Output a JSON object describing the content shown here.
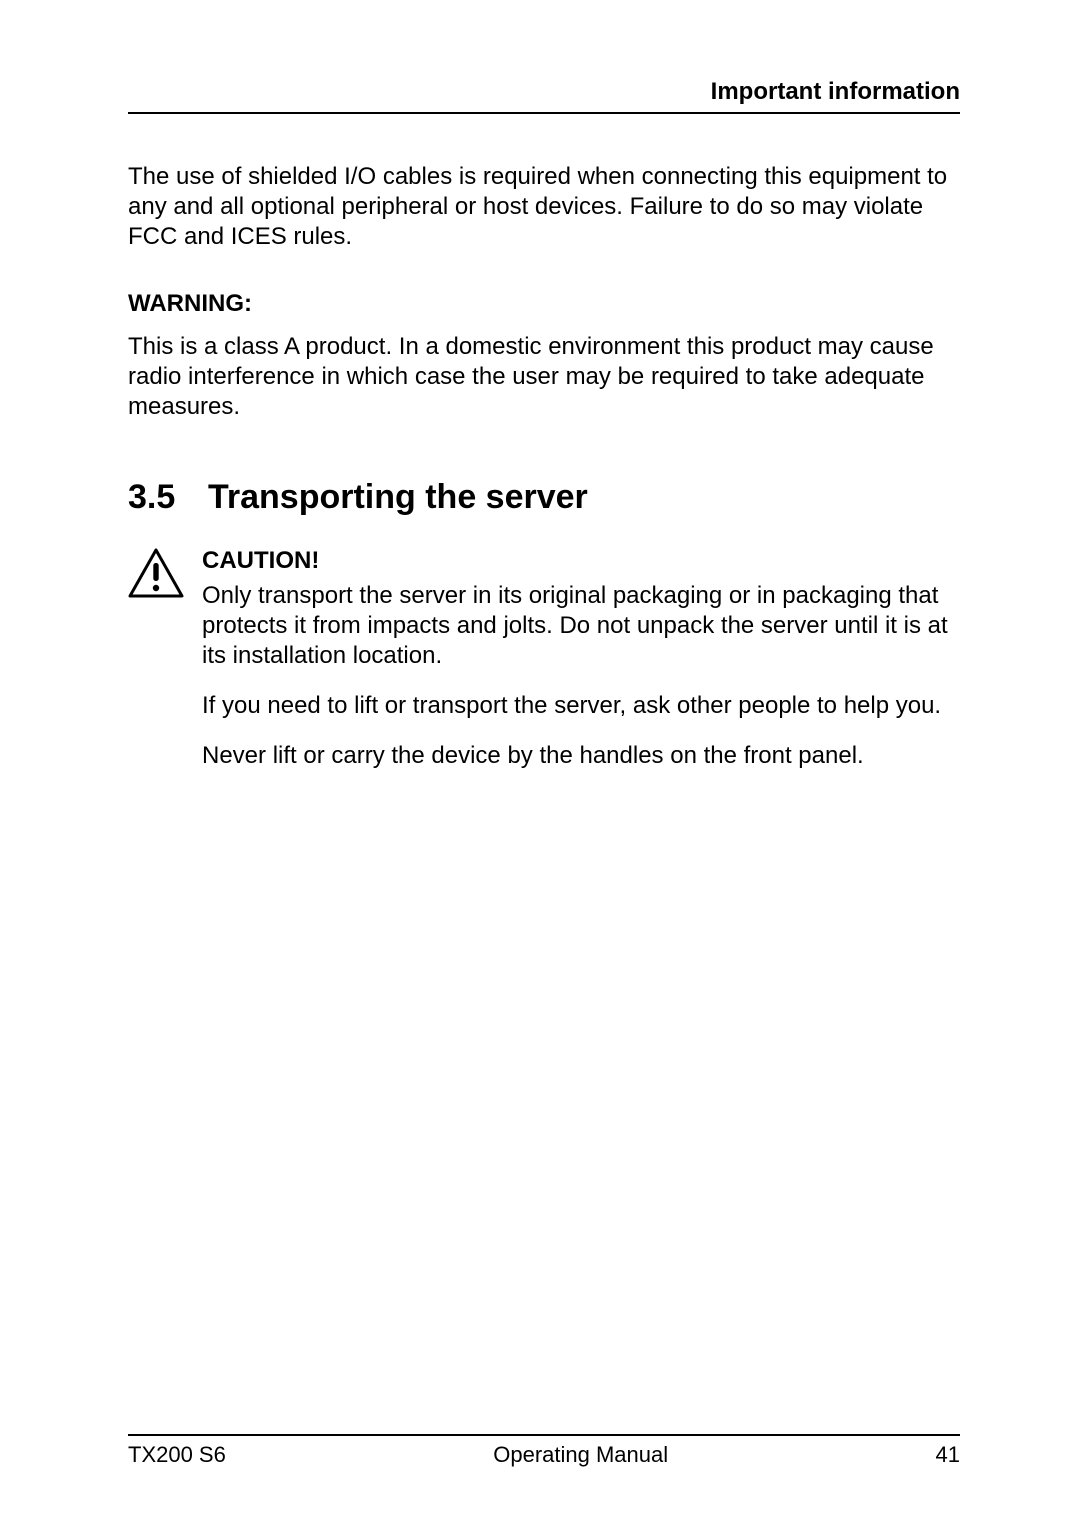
{
  "header": {
    "running_head": "Important information"
  },
  "intro_paragraph": "The use of shielded I/O cables is required when connecting this equipment to any and all optional peripheral or host devices. Failure to do so may violate FCC and ICES rules.",
  "warning": {
    "label": "WARNING:",
    "text": "This is a class A product. In a domestic environment this product may cause radio interference in which case the user may be required to take adequate measures."
  },
  "section": {
    "number": "3.5",
    "title": "Transporting the server"
  },
  "caution": {
    "label": "CAUTION!",
    "paragraphs": [
      "Only transport the server in its original packaging or in packaging that protects it from impacts and jolts. Do not unpack the server until it is at its installation location.",
      "If you need to lift or transport the server, ask other people to help you.",
      "Never lift or carry the device by the handles on the front panel."
    ]
  },
  "footer": {
    "left": "TX200 S6",
    "center": "Operating Manual",
    "right": "41"
  }
}
